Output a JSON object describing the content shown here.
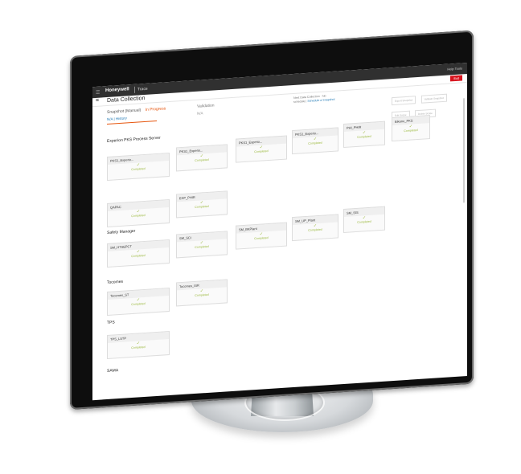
{
  "app": {
    "brand": "Honeywell",
    "name": "Trace",
    "menu_icon": "hamburger-icon",
    "utility": "Help  Tools"
  },
  "header": {
    "title": "Data Collection",
    "exit_label": "Exit"
  },
  "snapshot": {
    "label": "Snapshot (Manual)",
    "status": "In Progress",
    "sub": "N/A | History"
  },
  "validation": {
    "label": "Validation",
    "sub": "N/A"
  },
  "next_collection": {
    "line1": "Next Data Collection - No",
    "line2_prefix": "schedule |",
    "link": "Schedule a Snapshot"
  },
  "actions": [
    "Export Snapshot",
    "Validate Snapshot",
    "Edit Scope",
    "Delete Scope"
  ],
  "sections": [
    {
      "name": "Experion PKS Process Server"
    },
    {
      "name": "Safety Manager"
    },
    {
      "name": "Tocomes"
    },
    {
      "name": "TPS"
    },
    {
      "name": "SAMA"
    }
  ],
  "tiles": {
    "row1": [
      {
        "name": "PKS1_Experio...",
        "status": "Completed"
      },
      {
        "name": "PKS1_Experio...",
        "status": "Completed"
      },
      {
        "name": "PKS1_Experio...",
        "status": "Completed"
      },
      {
        "name": "PKS1_Experio...",
        "status": "Completed"
      },
      {
        "name": "PHI_PHIR",
        "status": "Completed"
      },
      {
        "name": "Eikano_PKS",
        "status": "Completed"
      }
    ],
    "row2": [
      {
        "name": "QAPAC",
        "status": "Completed"
      },
      {
        "name": "EXP_PHIR",
        "status": "Completed"
      }
    ],
    "row3": [
      {
        "name": "SM_HTSEPCT",
        "status": "Completed"
      },
      {
        "name": "SM_SCI",
        "status": "Completed"
      },
      {
        "name": "SM_BKPlant",
        "status": "Completed"
      },
      {
        "name": "SM_UP_Plant",
        "status": "Completed"
      },
      {
        "name": "SM_SIS",
        "status": "Completed"
      }
    ],
    "row4": [
      {
        "name": "Tocomes_ST",
        "status": "Completed"
      },
      {
        "name": "Tocomes_ISR",
        "status": "Completed"
      }
    ],
    "row5": [
      {
        "name": "TPS_LSTP",
        "status": "Completed"
      }
    ]
  }
}
